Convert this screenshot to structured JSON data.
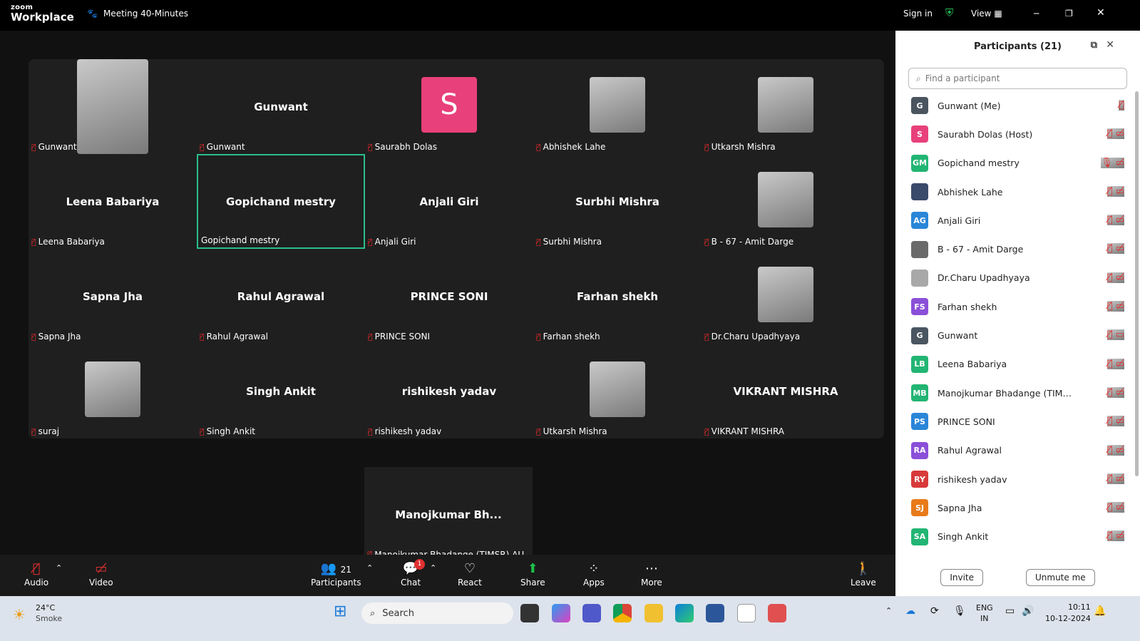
{
  "app": {
    "logo_top": "zoom",
    "logo_bottom": "Workplace",
    "meeting_title": "Meeting 40-Minutes",
    "sign_in": "Sign in",
    "view": "View"
  },
  "tiles": [
    {
      "name": "",
      "label": "Gunwant",
      "video": true,
      "muted": true
    },
    {
      "name": "Gunwant",
      "label": "Gunwant",
      "muted": true
    },
    {
      "name": "",
      "label": "Saurabh Dolas",
      "avatar_letter": "S",
      "avatar_color": "#e8407a",
      "muted": true
    },
    {
      "name": "",
      "label": "Abhishek Lahe",
      "video": true,
      "muted": true
    },
    {
      "name": "",
      "label": "Utkarsh Mishra",
      "video": true,
      "muted": true
    },
    {
      "name": "Leena Babariya",
      "label": "Leena Babariya",
      "muted": true
    },
    {
      "name": "Gopichand mestry",
      "label": "Gopichand mestry",
      "muted": false,
      "active": true
    },
    {
      "name": "Anjali Giri",
      "label": "Anjali Giri",
      "muted": true
    },
    {
      "name": "Surbhi Mishra",
      "label": "Surbhi Mishra",
      "muted": true
    },
    {
      "name": "",
      "label": "B - 67 - Amit Darge",
      "video": true,
      "muted": true
    },
    {
      "name": "Sapna Jha",
      "label": "Sapna Jha",
      "muted": true
    },
    {
      "name": "Rahul Agrawal",
      "label": "Rahul Agrawal",
      "muted": true
    },
    {
      "name": "PRINCE SONI",
      "label": "PRINCE SONI",
      "muted": true
    },
    {
      "name": "Farhan shekh",
      "label": "Farhan shekh",
      "muted": true
    },
    {
      "name": "",
      "label": "Dr.Charu Upadhyaya",
      "video": true,
      "muted": true
    },
    {
      "name": "",
      "label": "suraj",
      "video": true,
      "muted": true
    },
    {
      "name": "Singh Ankit",
      "label": "Singh Ankit",
      "muted": true
    },
    {
      "name": "rishikesh yadav",
      "label": "rishikesh yadav",
      "muted": true
    },
    {
      "name": "",
      "label": "Utkarsh Mishra",
      "video": true,
      "muted": true
    },
    {
      "name": "VIKRANT MISHRA",
      "label": "VIKRANT MISHRA",
      "muted": true
    }
  ],
  "extra_tile": {
    "name": "Manojkumar  Bh...",
    "label": "Manojkumar Bhadange (TIMSR) AU..."
  },
  "toolbar": {
    "audio": "Audio",
    "video": "Video",
    "participants": "Participants",
    "participants_count": "21",
    "chat": "Chat",
    "chat_badge": "1",
    "react": "React",
    "share": "Share",
    "apps": "Apps",
    "more": "More",
    "leave": "Leave"
  },
  "panel": {
    "title": "Participants (21)",
    "search_placeholder": "Find a participant",
    "invite": "Invite",
    "unmute": "Unmute me",
    "participants": [
      {
        "initials": "G",
        "color": "#4a5560",
        "name": "Gunwant (Me)"
      },
      {
        "initials": "S",
        "color": "#e8407a",
        "name": "Saurabh Dolas (Host)"
      },
      {
        "initials": "GM",
        "color": "#22b573",
        "name": "Gopichand mestry"
      },
      {
        "initials": "",
        "color": "#3a4a6a",
        "name": "Abhishek Lahe"
      },
      {
        "initials": "AG",
        "color": "#2a86d8",
        "name": "Anjali Giri"
      },
      {
        "initials": "",
        "color": "#6a6a6a",
        "name": "B - 67 - Amit Darge"
      },
      {
        "initials": "",
        "color": "#a8a8a8",
        "name": "Dr.Charu Upadhyaya"
      },
      {
        "initials": "FS",
        "color": "#8a4fd8",
        "name": "Farhan shekh"
      },
      {
        "initials": "G",
        "color": "#4a5560",
        "name": "Gunwant"
      },
      {
        "initials": "LB",
        "color": "#22b573",
        "name": "Leena Babariya"
      },
      {
        "initials": "MB",
        "color": "#22b573",
        "name": "Manojkumar Bhadange (TIMSR..."
      },
      {
        "initials": "PS",
        "color": "#2a86d8",
        "name": "PRINCE SONI"
      },
      {
        "initials": "RA",
        "color": "#8a4fd8",
        "name": "Rahul Agrawal"
      },
      {
        "initials": "RY",
        "color": "#d83a3a",
        "name": "rishikesh yadav"
      },
      {
        "initials": "SJ",
        "color": "#e87a1a",
        "name": "Sapna Jha"
      },
      {
        "initials": "SA",
        "color": "#22b573",
        "name": "Singh Ankit"
      }
    ]
  },
  "taskbar": {
    "temp": "24°C",
    "weather": "Smoke",
    "search": "Search",
    "lang1": "ENG",
    "lang2": "IN",
    "time": "10:11",
    "date": "10-12-2024"
  }
}
